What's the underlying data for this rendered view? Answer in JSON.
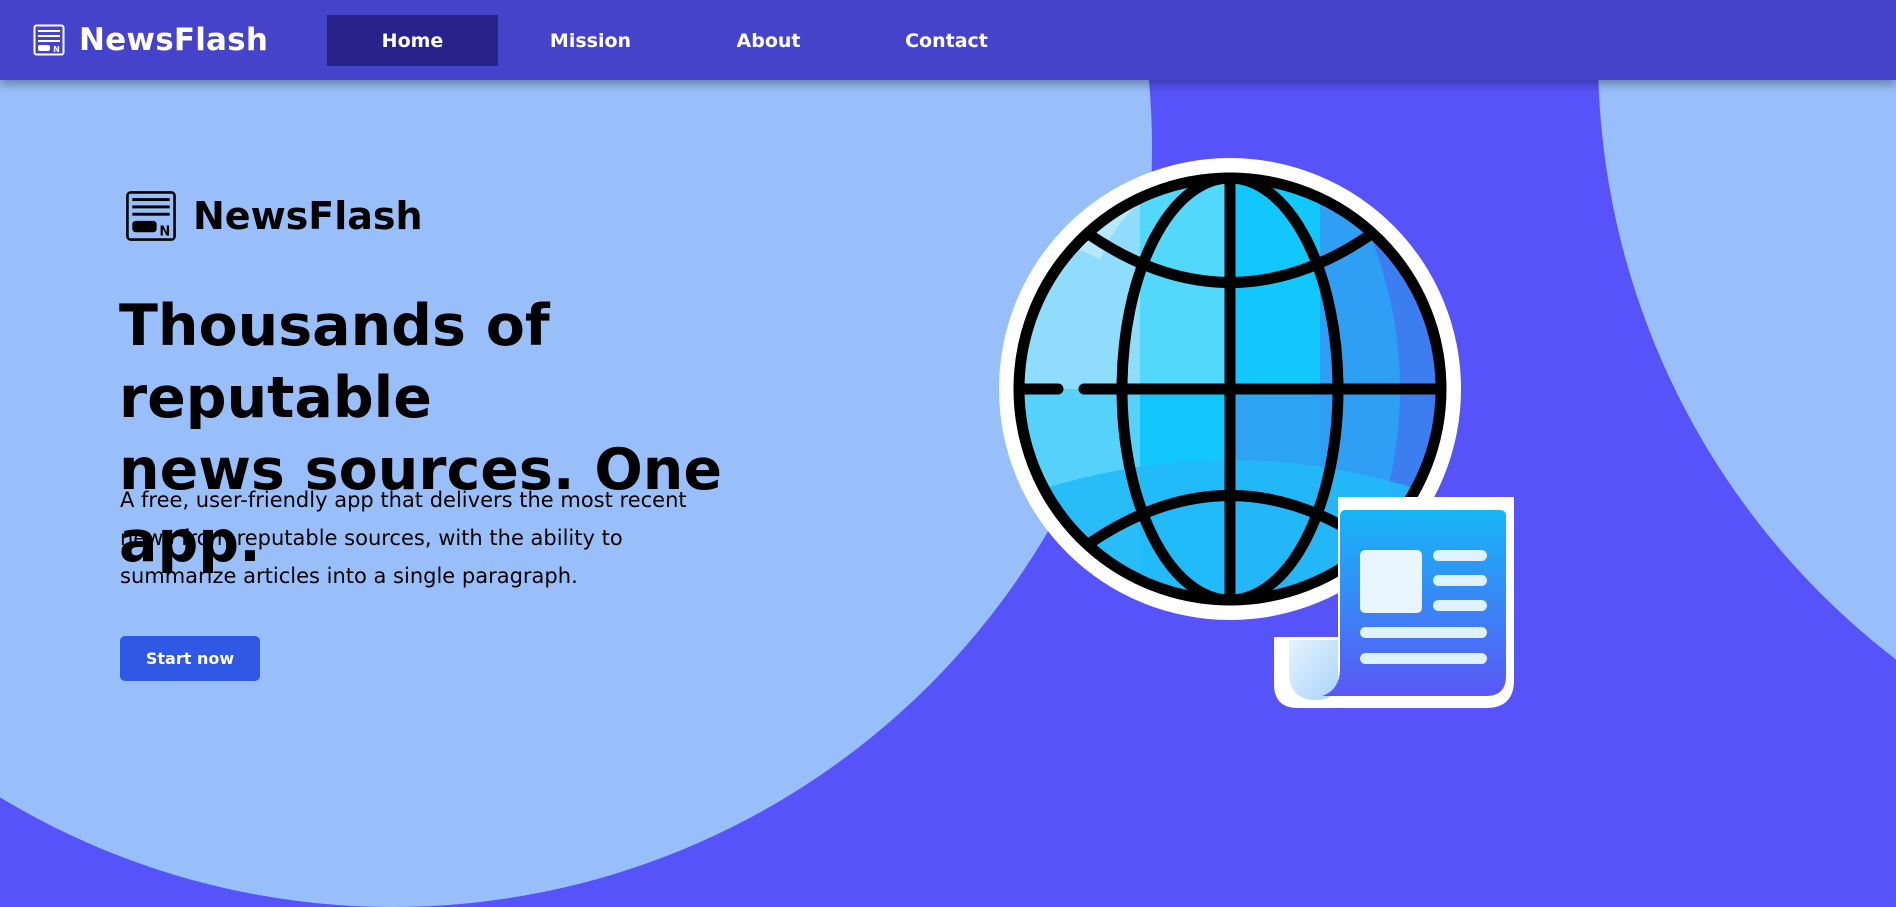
{
  "navbar": {
    "brand": {
      "logo_icon": "newspaper-icon",
      "name": "NewsFlash"
    },
    "items": [
      {
        "label": "Home",
        "active": true
      },
      {
        "label": "Mission",
        "active": false
      },
      {
        "label": "About",
        "active": false
      },
      {
        "label": "Contact",
        "active": false
      }
    ]
  },
  "hero": {
    "brand": {
      "logo_icon": "newspaper-icon",
      "name": "NewsFlash"
    },
    "headline_line1": "Thousands of reputable",
    "headline_line2": "news sources. One app.",
    "subtext_line1": "A free, user-friendly app that delivers the most recent",
    "subtext_line2": "news from reputable sources, with the ability to",
    "subtext_line3": "summarize articles into a single paragraph.",
    "cta_label": "Start now",
    "illustration_icon": "globe-with-newspaper-icon"
  },
  "colors": {
    "nav_background": "#4543ca",
    "nav_active": "#27238a",
    "page_background": "#5753fb",
    "light_blob": "#99bffb",
    "button": "#2f59e5"
  }
}
